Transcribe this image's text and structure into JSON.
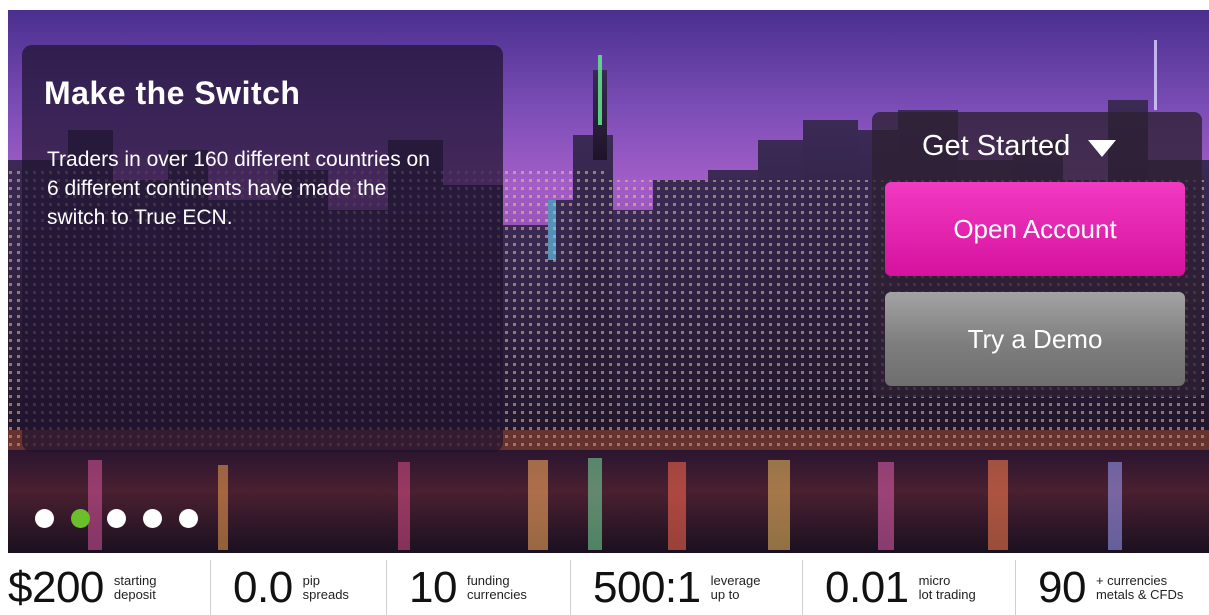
{
  "hero": {
    "title": "Make the Switch",
    "description": "Traders in over 160 different countries on 6 different continents have made the switch to True ECN.",
    "slides": [
      {
        "active": false
      },
      {
        "active": true
      },
      {
        "active": false
      },
      {
        "active": false
      },
      {
        "active": false
      }
    ]
  },
  "cta": {
    "heading": "Get Started",
    "open_account_label": "Open Account",
    "try_demo_label": "Try a Demo"
  },
  "stats": [
    {
      "value": "$200",
      "label": "starting\ndeposit"
    },
    {
      "value": "0.0",
      "label": "pip\nspreads"
    },
    {
      "value": "10",
      "label": "funding\ncurrencies"
    },
    {
      "value": "500:1",
      "label": "leverage\nup to"
    },
    {
      "value": "0.01",
      "label": "micro\nlot trading"
    },
    {
      "value": "90",
      "label": "+ currencies\nmetals & CFDs"
    }
  ],
  "colors": {
    "accent_pink": "#e0229f",
    "active_dot": "#6bbf2a",
    "demo_gray": "#8a8a8a"
  }
}
